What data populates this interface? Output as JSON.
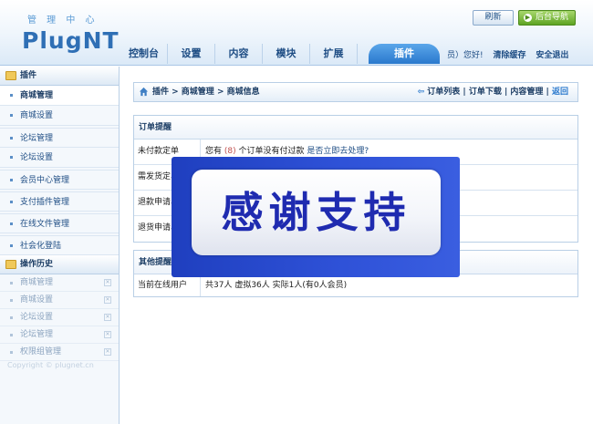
{
  "header": {
    "logo_subtitle": "管 理 中 心",
    "logo": "PlugNT",
    "refresh_label": "刷新",
    "backend_nav_label": "后台导航",
    "tabs": [
      {
        "label": "控制台"
      },
      {
        "label": "设置"
      },
      {
        "label": "内容"
      },
      {
        "label": "模块"
      },
      {
        "label": "扩展"
      },
      {
        "label": "插件"
      }
    ],
    "greeting": "员）您好!",
    "clear_cache": "清除缓存",
    "logout": "安全退出"
  },
  "sidebar": {
    "plugin_section": "插件",
    "items": [
      {
        "label": "商城管理"
      },
      {
        "label": "商城设置"
      },
      {
        "label": "论坛管理"
      },
      {
        "label": "论坛设置"
      },
      {
        "label": "会员中心管理"
      },
      {
        "label": "支付插件管理"
      },
      {
        "label": "在线文件管理"
      },
      {
        "label": "社会化登陆"
      }
    ],
    "history_section": "操作历史",
    "history": [
      {
        "label": "商城管理"
      },
      {
        "label": "商城设置"
      },
      {
        "label": "论坛设置"
      },
      {
        "label": "论坛管理"
      },
      {
        "label": "权限组管理"
      }
    ],
    "copyright": "Copyright © plugnet.cn"
  },
  "breadcrumb": {
    "path": "插件 > 商城管理 > 商城信息",
    "links": [
      "订单列表",
      "订单下载",
      "内容管理"
    ],
    "back": "返回"
  },
  "orders_box": {
    "title": "订单提醒",
    "rows": [
      {
        "label": "未付款定单",
        "prefix": "您有",
        "count": "(8)",
        "suffix": "个订单没有付过款",
        "action": "是否立即去处理?"
      },
      {
        "label": "需发货定单"
      },
      {
        "label": "退款申请单"
      },
      {
        "label": "退货申请单"
      }
    ]
  },
  "other_box": {
    "title": "其他提醒",
    "online_label": "当前在线用户",
    "online_value": "共37人  虚拟36人  实际1人(有0人会员)"
  },
  "overlay": {
    "text": "感谢支持"
  }
}
